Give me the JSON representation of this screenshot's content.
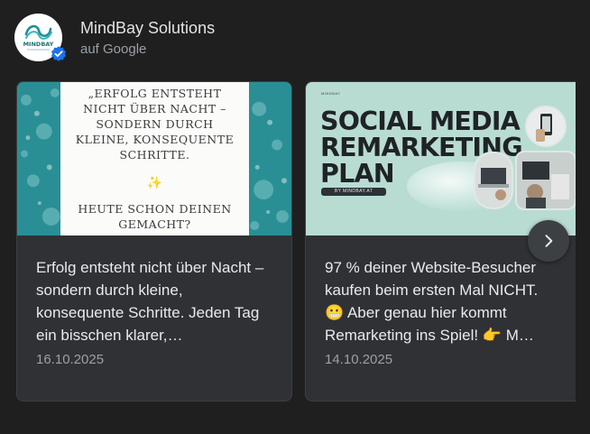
{
  "header": {
    "business_name": "MindBay Solutions",
    "source": "auf Google",
    "logo_text": "MINDBAY",
    "verified_icon": "verified-check-icon"
  },
  "posts": [
    {
      "image_quote_lines": [
        "„ERFOLG ENTSTEHT",
        "NICHT ÜBER NACHT –",
        "SONDERN DURCH",
        "KLEINE, KONSEQUENTE",
        "SCHRITTE."
      ],
      "image_footer_lines": [
        "HEUTE SCHON DEINEN",
        "GEMACHT?"
      ],
      "text": "Erfolg entsteht nicht über Nacht – sondern durch kleine, konsequente Schritte. Jeden Tag ein bisschen klarer,…",
      "date": "16.10.2025"
    },
    {
      "image_small_label": "MINDBAY",
      "image_title_lines": [
        "SOCIAL MEDIA",
        "REMARKETING",
        "PLAN"
      ],
      "image_byline": "BY MINDBAY.AT",
      "text": "97 % deiner Website-Besucher kaufen beim ersten Mal NICHT. 😬 Aber genau hier kommt Remarketing ins Spiel! 👉 M…",
      "date": "14.10.2025"
    }
  ],
  "controls": {
    "next_icon": "chevron-right-icon"
  },
  "colors": {
    "background": "#1f1f1f",
    "card": "#303134",
    "accent_teal": "#2a8f95",
    "verified_blue": "#1a73e8"
  }
}
